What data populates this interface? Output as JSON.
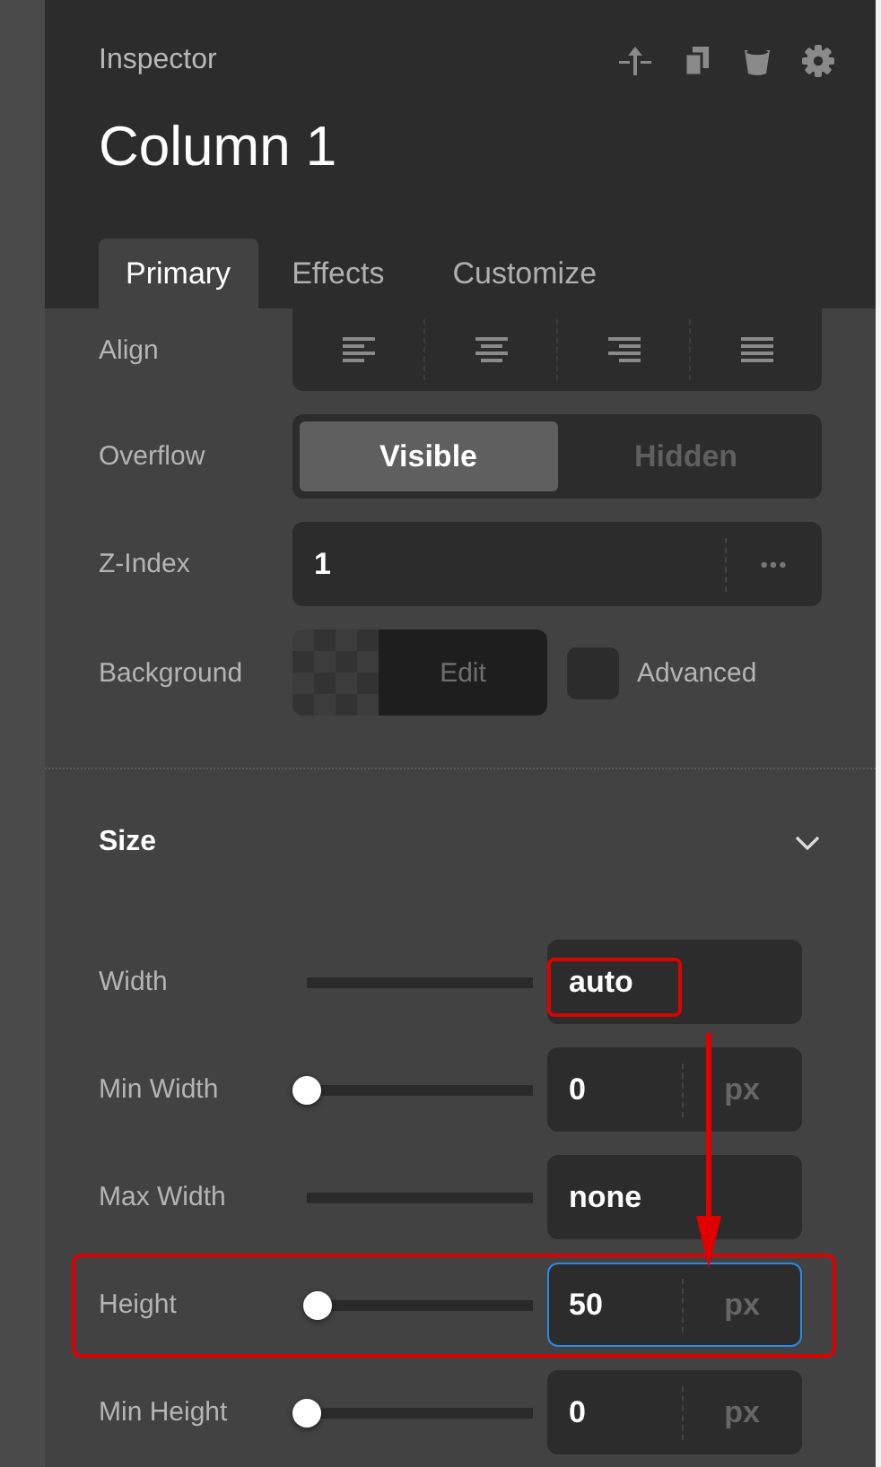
{
  "header": {
    "title": "Inspector",
    "element": "Column 1"
  },
  "tabs": [
    {
      "label": "Primary",
      "selected": true
    },
    {
      "label": "Effects",
      "selected": false
    },
    {
      "label": "Customize",
      "selected": false
    }
  ],
  "align": {
    "label": "Align"
  },
  "overflow": {
    "label": "Overflow",
    "options": [
      {
        "label": "Visible",
        "selected": true
      },
      {
        "label": "Hidden",
        "selected": false
      }
    ]
  },
  "z_index": {
    "label": "Z-Index",
    "value": "1",
    "more": "•••"
  },
  "background": {
    "label": "Background",
    "edit": "Edit",
    "advanced": {
      "label": "Advanced",
      "checked": false
    }
  },
  "size": {
    "title": "Size",
    "expanded": true,
    "arrow": true,
    "rows": [
      {
        "label": "Width",
        "kind": "track",
        "value": "auto",
        "value_circled": true,
        "row_circled": false,
        "focused": false
      },
      {
        "label": "Min Width",
        "kind": "slider",
        "level": 0,
        "value": "0",
        "unit": "px",
        "value_circled": false,
        "row_circled": false,
        "focused": false
      },
      {
        "label": "Max Width",
        "kind": "track",
        "value": "none",
        "value_circled": false,
        "row_circled": false,
        "focused": false
      },
      {
        "label": "Height",
        "kind": "slider",
        "level": 0.05,
        "value": "50",
        "unit": "px",
        "value_circled": false,
        "row_circled": true,
        "focused": true
      },
      {
        "label": "Min Height",
        "kind": "slider",
        "level": 0,
        "value": "0",
        "unit": "px",
        "value_circled": false,
        "row_circled": false,
        "focused": false
      }
    ]
  }
}
